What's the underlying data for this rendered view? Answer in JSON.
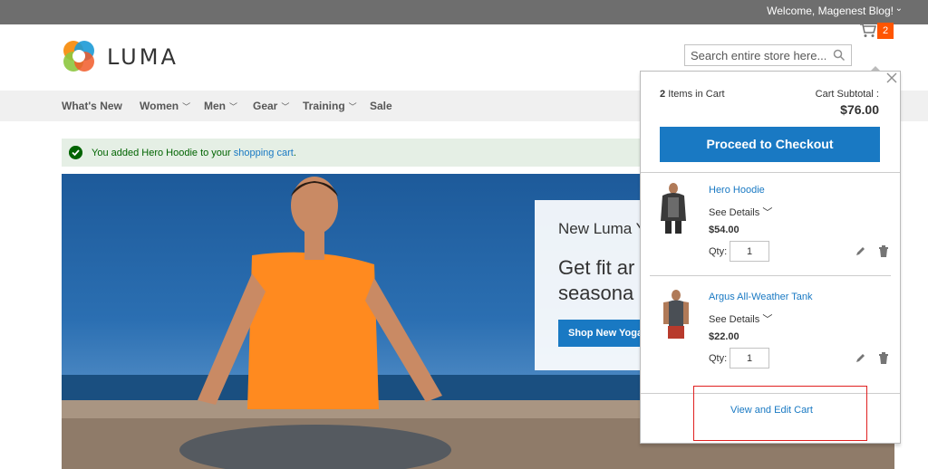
{
  "topbar": {
    "welcome": "Welcome, Magenest Blog!"
  },
  "header": {
    "brand": "LUMA",
    "search_placeholder": "Search entire store here...",
    "cart_count": "2"
  },
  "nav": {
    "items": [
      {
        "label": "What's New",
        "has_dropdown": false
      },
      {
        "label": "Women",
        "has_dropdown": true
      },
      {
        "label": "Men",
        "has_dropdown": true
      },
      {
        "label": "Gear",
        "has_dropdown": true
      },
      {
        "label": "Training",
        "has_dropdown": true
      },
      {
        "label": "Sale",
        "has_dropdown": false
      }
    ]
  },
  "message": {
    "text": "You added Hero Hoodie to your ",
    "link": "shopping cart",
    "suffix": "."
  },
  "promo": {
    "small": "New Luma Y",
    "big_line1": "Get fit ar",
    "big_line2": "seasona",
    "button": "Shop New Yoga"
  },
  "minicart": {
    "items_count": "2",
    "items_label": "Items in Cart",
    "subtotal_label": "Cart Subtotal :",
    "subtotal_value": "$76.00",
    "checkout_label": "Proceed to Checkout",
    "products": [
      {
        "name": "Hero Hoodie",
        "details": "See Details",
        "price": "$54.00",
        "qty_label": "Qty:",
        "qty": "1"
      },
      {
        "name": "Argus All-Weather Tank",
        "details": "See Details",
        "price": "$22.00",
        "qty_label": "Qty:",
        "qty": "1"
      }
    ],
    "view_cart": "View and Edit Cart"
  },
  "colors": {
    "accent": "#1979c3",
    "badge": "#ff5501",
    "success": "#006400",
    "highlight": "#e02020"
  }
}
